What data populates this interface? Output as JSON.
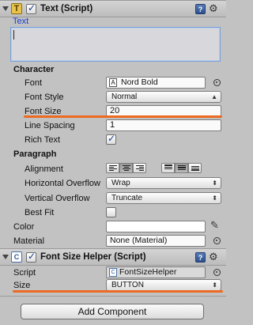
{
  "text_component": {
    "title": "Text (Script)",
    "text_label": "Text",
    "text_value": "",
    "character_section": "Character",
    "font_label": "Font",
    "font_value": "Nord Bold",
    "font_style_label": "Font Style",
    "font_style_value": "Normal",
    "font_size_label": "Font Size",
    "font_size_value": "20",
    "line_spacing_label": "Line Spacing",
    "line_spacing_value": "1",
    "rich_text_label": "Rich Text",
    "rich_text_checked": true,
    "paragraph_section": "Paragraph",
    "alignment_label": "Alignment",
    "horizontal_overflow_label": "Horizontal Overflow",
    "horizontal_overflow_value": "Wrap",
    "vertical_overflow_label": "Vertical Overflow",
    "vertical_overflow_value": "Truncate",
    "best_fit_label": "Best Fit",
    "best_fit_checked": false,
    "color_label": "Color",
    "material_label": "Material",
    "material_value": "None (Material)"
  },
  "font_size_helper": {
    "title": "Font Size Helper (Script)",
    "script_label": "Script",
    "script_value": "FontSizeHelper",
    "size_label": "Size",
    "size_value": "BUTTON"
  },
  "add_component_label": "Add Component",
  "colors": {
    "accent_underline": "#ec6a21",
    "text_label_blue": "#1d3fcf",
    "panel_bg": "#c2c2c2"
  }
}
